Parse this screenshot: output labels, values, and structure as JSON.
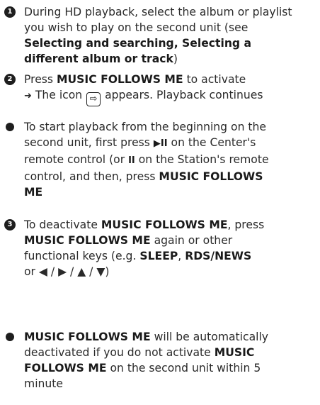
{
  "step1": {
    "number": "1",
    "line1": "During HD playback, select the album or playlist",
    "line2": "you wish to play on the second unit (see",
    "bold1": "Selecting and searching, Selecting a",
    "bold2": "different album or track",
    "close": ")"
  },
  "step2": {
    "number": "2",
    "pre": "Press ",
    "bold": "MUSIC FOLLOWS ME",
    "post": " to activate",
    "arrow": "➜",
    "result_pre": " The icon ",
    "icon": "⇨",
    "result_post": " appears. Playback continues"
  },
  "bullet1": {
    "line1": "To start playback from the beginning on the",
    "line2_pre": "second unit,  first press ",
    "playpause": "▶II",
    "line2_post": " on the Center's",
    "line3_pre": "remote control (or ",
    "pause": "II",
    "line3_post": " on the Station's remote",
    "line4_pre": "control, and then, press ",
    "line4_bold": "MUSIC FOLLOWS",
    "line5_bold": "ME"
  },
  "step3": {
    "number": "3",
    "pre": "To deactivate ",
    "bold1": "MUSIC FOLLOWS ME",
    "mid": ", press",
    "bold2": "MUSIC FOLLOWS ME",
    "line2_post": " again or other",
    "line3_pre": "functional keys (e.g. ",
    "sleep": "SLEEP",
    "comma": ", ",
    "rds": "RDS/NEWS",
    "line4": "or  ◀ / ▶ / ▲ / ▼)"
  },
  "bullet2": {
    "bold1": "MUSIC FOLLOWS ME",
    "line1_post": " will be automatically",
    "line2_pre": "deactivated if you do not activate ",
    "bold2": "MUSIC",
    "bold3": "FOLLOWS ME",
    "line3_post": " on the second unit within 5",
    "line4": "minute"
  }
}
